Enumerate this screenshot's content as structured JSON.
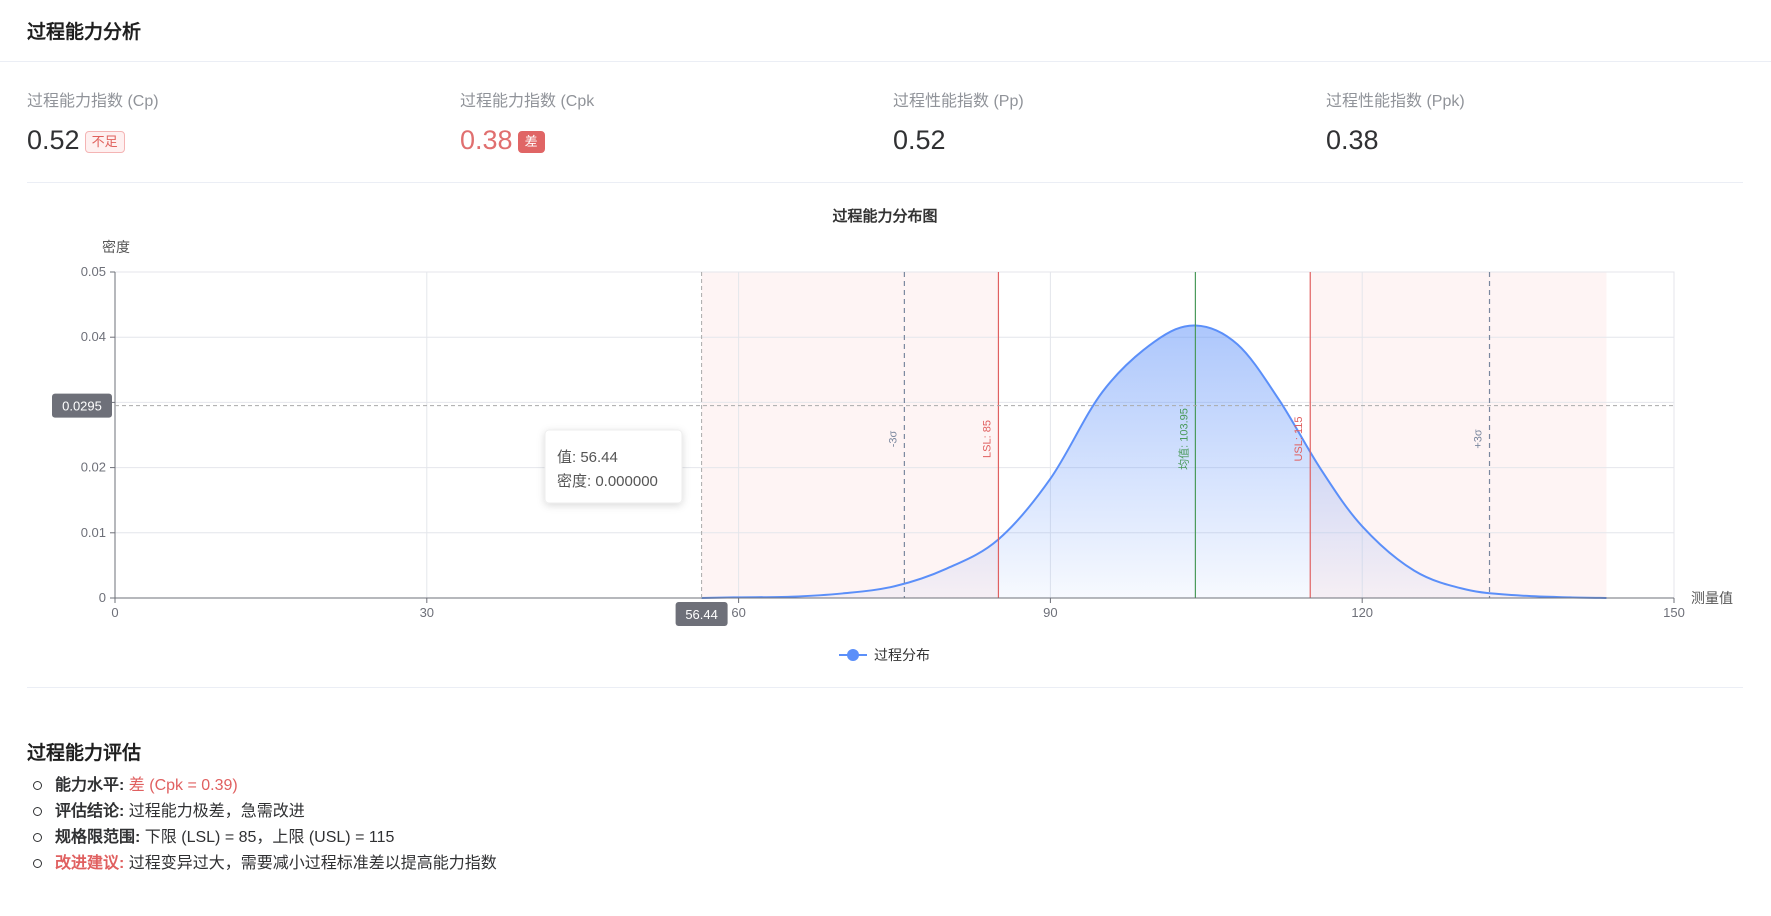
{
  "page": {
    "title": "过程能力分析"
  },
  "metrics": [
    {
      "label": "过程能力指数 (Cp)",
      "value": "0.52",
      "tag": "不足",
      "tone": "normal",
      "tag_style": "plain"
    },
    {
      "label": "过程能力指数 (Cpk",
      "value": "0.38",
      "tag": "差",
      "tone": "danger",
      "tag_style": "dark"
    },
    {
      "label": "过程性能指数 (Pp)",
      "value": "0.52",
      "tag": "",
      "tone": "normal",
      "tag_style": ""
    },
    {
      "label": "过程性能指数 (Ppk)",
      "value": "0.38",
      "tag": "",
      "tone": "normal",
      "tag_style": ""
    }
  ],
  "chart_data": {
    "type": "area",
    "title": "过程能力分布图",
    "xlabel": "测量值",
    "ylabel": "密度",
    "xlim": [
      0,
      150
    ],
    "ylim": [
      0,
      0.05
    ],
    "x_ticks": [
      0,
      30,
      60,
      90,
      120,
      150
    ],
    "x_tick_labels": [
      "0",
      "30",
      "60",
      "90",
      "120",
      "150"
    ],
    "y_ticks": [
      0,
      0.01,
      0.02,
      0.03,
      0.04,
      0.05
    ],
    "y_tick_labels": [
      "0",
      "0.01",
      "0.02",
      "0.03",
      "0.04",
      "0.05"
    ],
    "series": [
      {
        "name": "过程分布",
        "color": "#5b8ff9",
        "x": [
          56.44,
          60,
          65,
          70,
          75,
          80,
          85,
          90,
          95,
          100,
          103.95,
          108,
          112,
          116,
          120,
          125,
          130,
          135,
          140,
          143.5
        ],
        "y": [
          0.0,
          0.0001,
          0.0002,
          0.0007,
          0.0018,
          0.0045,
          0.009,
          0.0183,
          0.0316,
          0.0393,
          0.0418,
          0.0389,
          0.0304,
          0.0198,
          0.011,
          0.0042,
          0.0013,
          0.0004,
          0.0001,
          0.0
        ]
      }
    ],
    "reference_lines": [
      {
        "label": "-3σ",
        "x": 75.95,
        "color": "#7a879e",
        "style": "dashed"
      },
      {
        "label": "LSL: 85",
        "x": 85,
        "color": "#e06060",
        "style": "solid"
      },
      {
        "label": "均值: 103.95",
        "x": 103.95,
        "color": "#4a9a5a",
        "style": "solid"
      },
      {
        "label": "USL: 115",
        "x": 115,
        "color": "#e06060",
        "style": "solid"
      },
      {
        "label": "+3σ",
        "x": 132.25,
        "color": "#7a879e",
        "style": "dashed"
      }
    ],
    "out_of_spec_bands": [
      {
        "from": 56.44,
        "to": 85
      },
      {
        "from": 115,
        "to": 143.5
      }
    ],
    "tooltip": {
      "value_line": "值: 56.44",
      "density_line": "密度: 0.000000"
    },
    "crosshair": {
      "x": 56.44,
      "y": 0.0295,
      "x_label": "56.44",
      "y_label": "0.0295"
    },
    "legend": "bottom-center",
    "grid": true
  },
  "assessment": {
    "title": "过程能力评估",
    "items": [
      {
        "key": "能力水平:",
        "value": "差 (Cpk = 0.39)",
        "key_red": false,
        "value_red": true
      },
      {
        "key": "评估结论:",
        "value": "过程能力极差，急需改进",
        "key_red": false,
        "value_red": false
      },
      {
        "key": "规格限范围:",
        "value": "下限 (LSL) = 85，上限 (USL) = 115",
        "key_red": false,
        "value_red": false
      },
      {
        "key": "改进建议:",
        "value": "过程变异过大，需要减小过程标准差以提高能力指数",
        "key_red": true,
        "value_red": false
      }
    ]
  }
}
